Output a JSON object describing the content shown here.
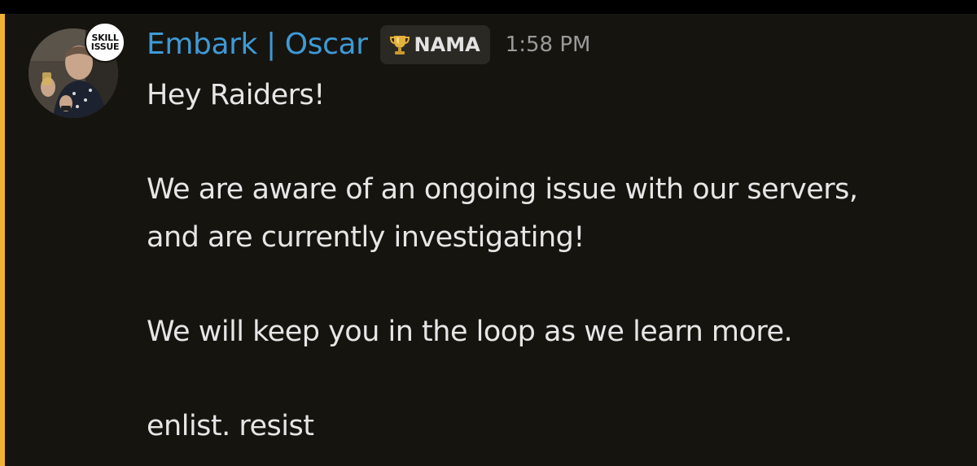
{
  "colors": {
    "accent_bar": "#f0b232",
    "username": "#3e9ad6",
    "background": "#16140f",
    "message_text": "#e6e6e6",
    "timestamp_text": "#9a9a9a",
    "role_tag_bg": "#2b2924"
  },
  "message": {
    "author": "Embark | Oscar",
    "role": {
      "icon": "trophy-icon",
      "label": "NAMA"
    },
    "timestamp": "1:58 PM",
    "avatar_badge": [
      "SKILL",
      "ISSUE"
    ],
    "lines": [
      "Hey Raiders!",
      "We are aware of an ongoing issue with our servers,",
      "and are currently investigating!",
      "We will keep you in the loop as we learn more.",
      "enlist. resist"
    ]
  }
}
